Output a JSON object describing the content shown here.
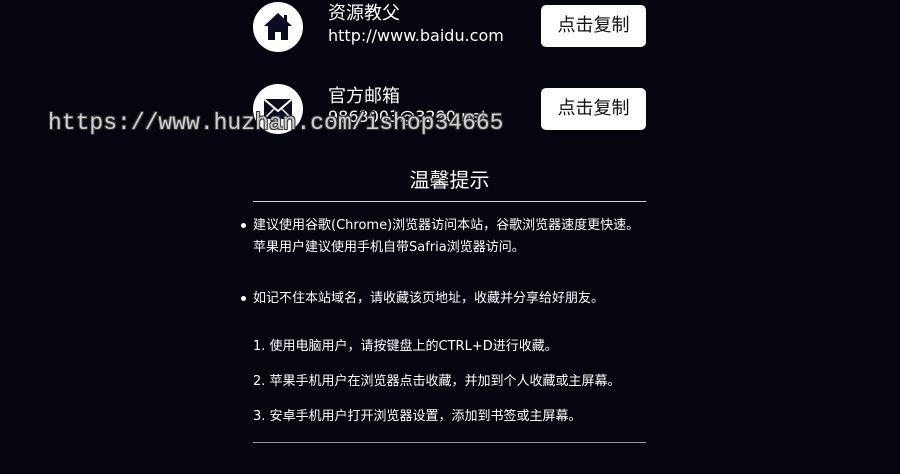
{
  "contacts": [
    {
      "icon": "home-icon",
      "title": "资源教父",
      "value": "http://www.baidu.com",
      "button_label": "点击复制"
    },
    {
      "icon": "mail-icon",
      "title": "官方邮箱",
      "value": "9863003@3290.net",
      "button_label": "点击复制"
    }
  ],
  "watermark": "https://www.huzhan.com/ishop34665",
  "tips": {
    "heading": "温馨提示",
    "bullets": [
      {
        "lines": [
          "建议使用谷歌(Chrome)浏览器访问本站，谷歌浏览器速度更快速。",
          "苹果用户建议使用手机自带Safria浏览器访问。"
        ]
      },
      {
        "lines": [
          "如记不住本站域名，请收藏该页地址，收藏并分享给好朋友。"
        ]
      }
    ],
    "steps": [
      "1. 使用电脑用户，请按键盘上的CTRL+D进行收藏。",
      "2. 苹果手机用户在浏览器点击收藏，并加到个人收藏或主屏幕。",
      "3. 安卓手机用户打开浏览器设置，添加到书签或主屏幕。"
    ]
  },
  "colors": {
    "background": "#05050f",
    "text": "#ffffff",
    "button_bg": "#ffffff",
    "button_text": "#111111",
    "icon_dark": "#0b0b22",
    "divider": "#d8d8d8"
  }
}
